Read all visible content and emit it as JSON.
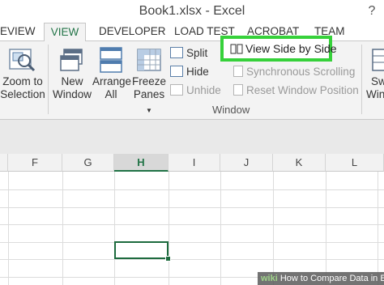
{
  "window": {
    "title": "Book1.xlsx - Excel",
    "help": "?"
  },
  "tabs": [
    {
      "label": "EVIEW",
      "active": false
    },
    {
      "label": "VIEW",
      "active": true
    },
    {
      "label": "DEVELOPER",
      "active": false
    },
    {
      "label": "LOAD TEST",
      "active": false
    },
    {
      "label": "ACROBAT",
      "active": false
    },
    {
      "label": "TEAM",
      "active": false
    }
  ],
  "ribbon": {
    "zoom_to_selection": [
      "Zoom to",
      "Selection"
    ],
    "new_window": [
      "New",
      "Window"
    ],
    "arrange_all": [
      "Arrange",
      "All"
    ],
    "freeze_panes": [
      "Freeze",
      "Panes"
    ],
    "split": "Split",
    "hide": "Hide",
    "unhide": "Unhide",
    "view_side_by_side": "View Side by Side",
    "synchronous_scrolling": "Synchronous Scrolling",
    "reset_window_position": "Reset Window Position",
    "switch_windows": [
      "Sw",
      "Wind"
    ],
    "group_label": "Window"
  },
  "columns": [
    "F",
    "G",
    "H",
    "I",
    "J",
    "K",
    "L"
  ],
  "selected_column": "H",
  "watermark": {
    "brand": "wiki",
    "text": "How to Compare Data in Excel"
  }
}
